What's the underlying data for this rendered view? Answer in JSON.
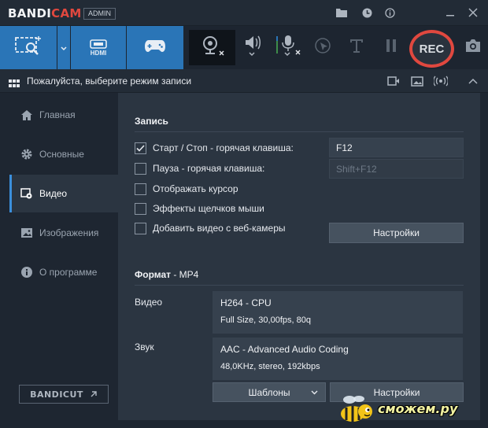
{
  "app": {
    "brand_first": "BANDI",
    "brand_second": "CAM",
    "badge": "ADMIN"
  },
  "titlebar": {
    "icons": [
      "folder-icon",
      "clock-icon",
      "info-icon",
      "minimize-icon",
      "close-icon"
    ]
  },
  "toolbar": {
    "hdmi_label": "HDMI",
    "rec_label": "REC",
    "tools": [
      "webcam-icon",
      "speaker-icon",
      "microphone-icon",
      "cursor-click-icon",
      "text-icon",
      "pause-icon",
      "camera-icon"
    ]
  },
  "modebar": {
    "label": "Пожалуйста, выберите режим записи"
  },
  "sidebar": {
    "items": [
      {
        "label": "Главная",
        "icon": "home-icon"
      },
      {
        "label": "Основные",
        "icon": "gear-icon"
      },
      {
        "label": "Видео",
        "icon": "video-settings-icon",
        "active": true
      },
      {
        "label": "Изображения",
        "icon": "image-icon"
      },
      {
        "label": "О программе",
        "icon": "info-icon"
      }
    ],
    "bandicut_first": "BANDI",
    "bandicut_second": "CUT"
  },
  "record": {
    "title": "Запись",
    "options": [
      {
        "label": "Старт / Стоп - горячая клавиша:",
        "checked": true
      },
      {
        "label": "Пауза - горячая клавиша:",
        "checked": false
      },
      {
        "label": "Отображать курсор",
        "checked": false
      },
      {
        "label": "Эффекты щелчков мыши",
        "checked": false
      },
      {
        "label": "Добавить видео с веб-камеры",
        "checked": false
      }
    ],
    "hotkey_start": "F12",
    "hotkey_pause": "Shift+F12",
    "settings_button": "Настройки"
  },
  "format": {
    "title": "Формат",
    "subtitle": " - MP4",
    "video_label": "Видео",
    "video_codec": "H264 - CPU",
    "video_details": "Full Size, 30,00fps, 80q",
    "audio_label": "Звук",
    "audio_codec": "AAC - Advanced Audio Coding",
    "audio_details": "48,0KHz, stereo, 192kbps",
    "templates_button": "Шаблоны",
    "settings_button": "Настройки"
  },
  "watermark": {
    "text": "сможем.ру"
  },
  "colors": {
    "accent": "#2a75b7",
    "rec": "#e0483f",
    "panel": "#2b3541",
    "background": "#1e2631"
  }
}
